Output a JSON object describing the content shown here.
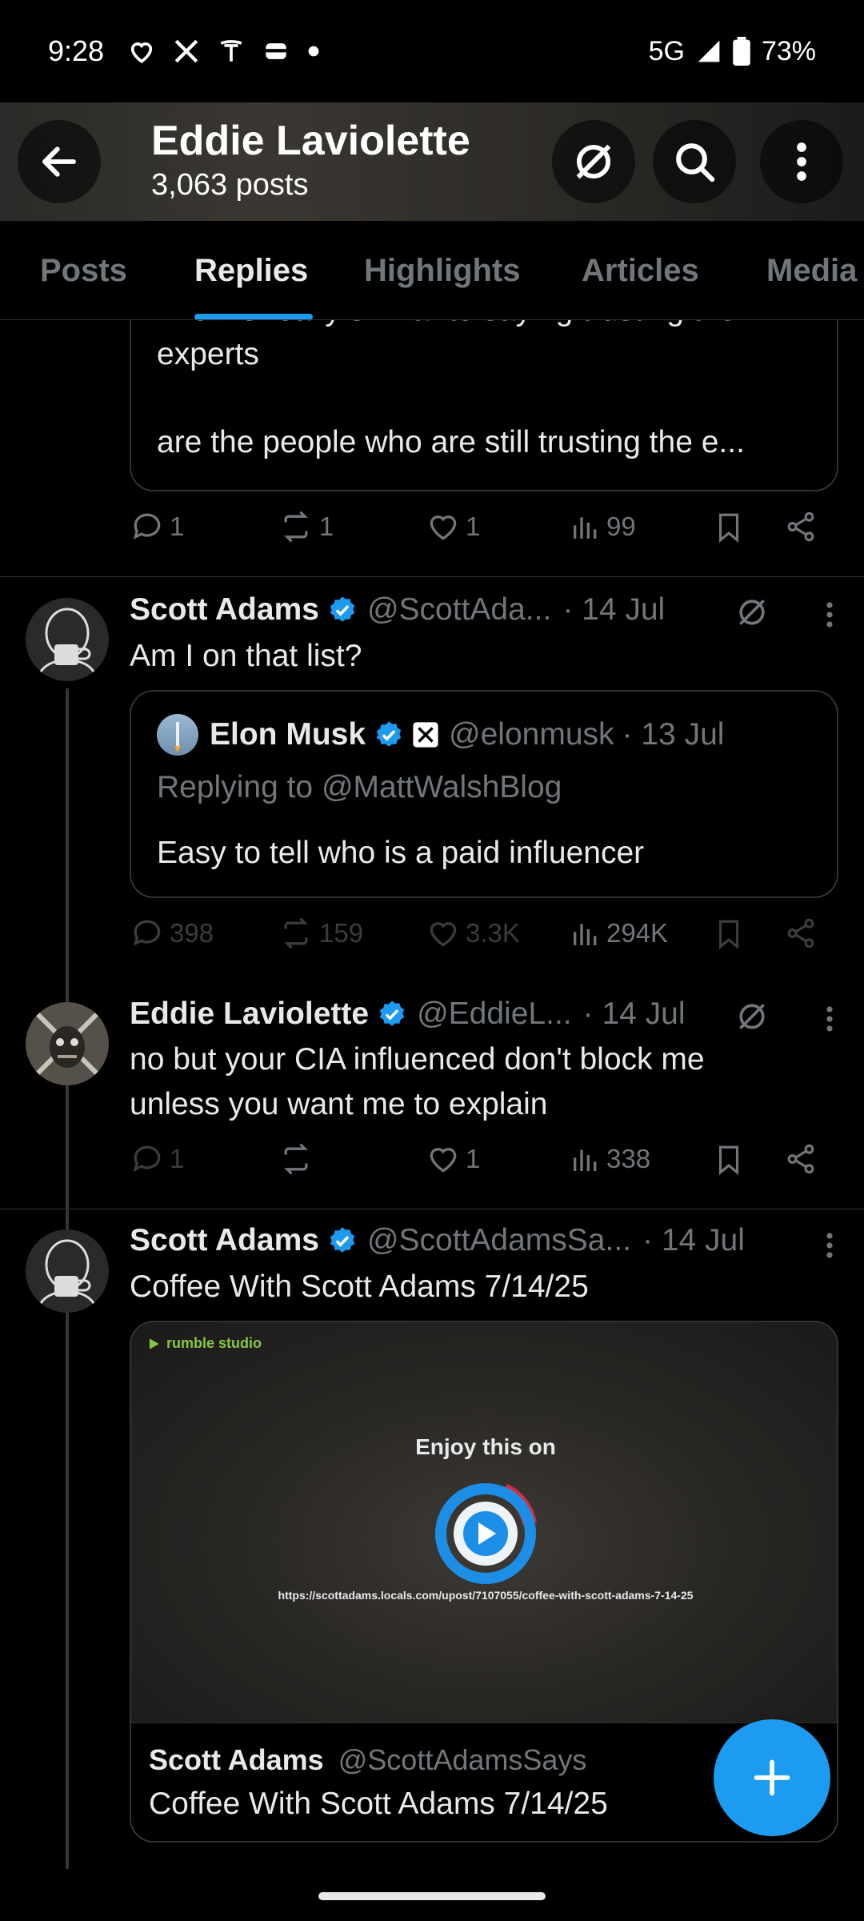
{
  "status_bar": {
    "time": "9:28",
    "network": "5G",
    "battery": "73%"
  },
  "header": {
    "name": "Eddie Laviolette",
    "posts": "3,063 posts"
  },
  "tabs": [
    {
      "label": "Posts"
    },
    {
      "label": "Replies"
    },
    {
      "label": "Highlights"
    },
    {
      "label": "Articles"
    },
    {
      "label": "Media"
    }
  ],
  "active_tab": "Replies",
  "post0": {
    "quote_lines": [
      "hired is really similar to saying trusting the",
      "experts",
      "are the people who are still trusting the e..."
    ],
    "actions": {
      "replies": "1",
      "reposts": "1",
      "likes": "1",
      "views": "99"
    }
  },
  "post1": {
    "name": "Scott Adams",
    "handle": "@ScottAda...",
    "date": "· 14 Jul",
    "text": "Am I on that list?",
    "quote": {
      "name": "Elon Musk",
      "handle": "@elonmusk",
      "date": "· 13 Jul",
      "replying_to": "Replying to @MattWalshBlog",
      "text": "Easy to tell who is a paid influencer"
    },
    "actions": {
      "replies": "398",
      "reposts": "159",
      "likes": "3.3K",
      "views": "294K"
    }
  },
  "post2": {
    "name": "Eddie Laviolette",
    "handle": "@EddieL...",
    "date": "· 14 Jul",
    "text_line1": "no but your CIA influenced don't block me",
    "text_line2": "unless you want me to explain",
    "actions": {
      "replies": "1",
      "reposts": "",
      "likes": "1",
      "views": "338"
    }
  },
  "post3": {
    "name": "Scott Adams",
    "handle": "@ScottAdamsSa...",
    "date": "· 14 Jul",
    "text": "Coffee With Scott Adams 7/14/25",
    "media": {
      "brand": "rumble studio",
      "overlay_title": "Enjoy this on",
      "url": "https://scottadams.locals.com/upost/7107055/coffee-with-scott-adams-7-14-25"
    },
    "card": {
      "name": "Scott Adams",
      "handle": "@ScottAdamsSays",
      "title": "Coffee With Scott Adams 7/14/25"
    }
  },
  "colors": {
    "accent": "#1d9bf0",
    "muted": "#71767b",
    "text": "#e7e9ea",
    "background": "#000000"
  },
  "icons": [
    "back-arrow-icon",
    "grok-icon",
    "search-icon",
    "more-vertical-icon",
    "reply-icon",
    "repost-icon",
    "like-icon",
    "views-icon",
    "bookmark-icon",
    "share-icon",
    "verified-badge-icon",
    "play-icon",
    "compose-plus-icon"
  ]
}
